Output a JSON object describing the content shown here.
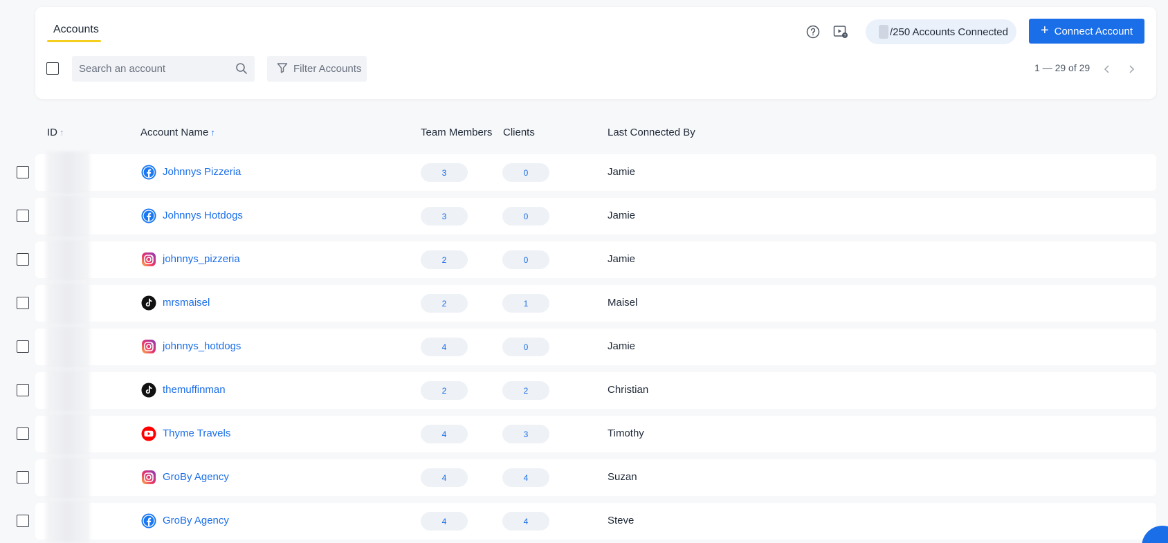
{
  "tabs": [
    {
      "label": "Accounts",
      "active": true
    }
  ],
  "header": {
    "help_icon": "help-circle-icon",
    "video_icon": "video-help-icon",
    "accounts_connected": "/250 Accounts Connected",
    "connect_button": "Connect Account"
  },
  "search": {
    "placeholder": "Search an account"
  },
  "filter": {
    "label": "Filter Accounts"
  },
  "pagination": {
    "text": "1 — 29 of 29"
  },
  "columns": {
    "id": "ID",
    "account_name": "Account Name",
    "team_members": "Team Members",
    "clients": "Clients",
    "last_connected_by": "Last Connected By"
  },
  "rows": [
    {
      "platform": "facebook",
      "name": "Johnnys Pizzeria",
      "team_members": "3",
      "clients": "0",
      "last_connected_by": "Jamie"
    },
    {
      "platform": "facebook",
      "name": "Johnnys Hotdogs",
      "team_members": "3",
      "clients": "0",
      "last_connected_by": "Jamie"
    },
    {
      "platform": "instagram",
      "name": "johnnys_pizzeria",
      "team_members": "2",
      "clients": "0",
      "last_connected_by": "Jamie"
    },
    {
      "platform": "tiktok",
      "name": "mrsmaisel",
      "team_members": "2",
      "clients": "1",
      "last_connected_by": "Maisel"
    },
    {
      "platform": "instagram",
      "name": "johnnys_hotdogs",
      "team_members": "4",
      "clients": "0",
      "last_connected_by": "Jamie"
    },
    {
      "platform": "tiktok",
      "name": "themuffinman",
      "team_members": "2",
      "clients": "2",
      "last_connected_by": "Christian"
    },
    {
      "platform": "youtube",
      "name": "Thyme Travels",
      "team_members": "4",
      "clients": "3",
      "last_connected_by": "Timothy"
    },
    {
      "platform": "instagram",
      "name": "GroBy Agency",
      "team_members": "4",
      "clients": "4",
      "last_connected_by": "Suzan"
    },
    {
      "platform": "facebook",
      "name": "GroBy Agency",
      "team_members": "4",
      "clients": "4",
      "last_connected_by": "Steve"
    }
  ],
  "colors": {
    "accent": "#1a6ee8",
    "tab_underline": "#f5cf1d"
  }
}
